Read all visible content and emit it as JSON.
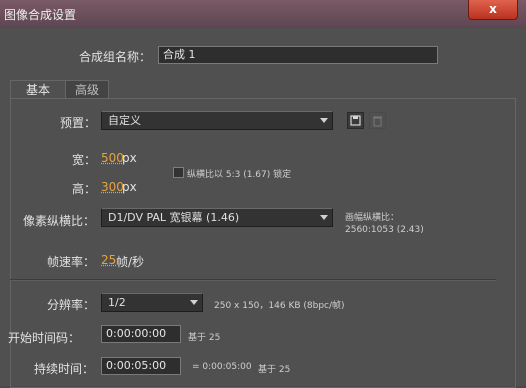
{
  "window": {
    "title": "图像合成设置",
    "close_label": "x"
  },
  "comp_name": {
    "label": "合成组名称：",
    "value": "合成 1"
  },
  "tabs": [
    {
      "label": "基本"
    },
    {
      "label": "高级"
    }
  ],
  "preset": {
    "label": "预置：",
    "value": "自定义"
  },
  "width": {
    "label": "宽：",
    "value": "500",
    "unit": "px"
  },
  "lock_aspect": {
    "label": "纵横比以 5:3 (1.67) 锁定",
    "checked": false
  },
  "height": {
    "label": "高：",
    "value": "300",
    "unit": "px"
  },
  "pixel_aspect": {
    "label": "像素纵横比：",
    "value": "D1/DV PAL 宽银幕 (1.46)"
  },
  "frame_aspect": {
    "label": "画幅纵横比：",
    "value": "2560:1053 (2.43)"
  },
  "frame_rate": {
    "label": "帧速率：",
    "value": "25",
    "unit": "帧/秒"
  },
  "resolution": {
    "label": "分辨率：",
    "value": "1/2",
    "info": "250 x 150，146 KB (8bpc/帧)"
  },
  "start_timecode": {
    "label": "开始时间码：",
    "value": "0:00:00:00",
    "base": "基于 25"
  },
  "duration": {
    "label": "持续时间：",
    "value": "0:00:05:00",
    "equals": "= 0:00:05:00",
    "base": "基于 25"
  },
  "colors": {
    "accent": "#e7a33b",
    "titlebar": "#6a505c",
    "close": "#c8402b"
  }
}
